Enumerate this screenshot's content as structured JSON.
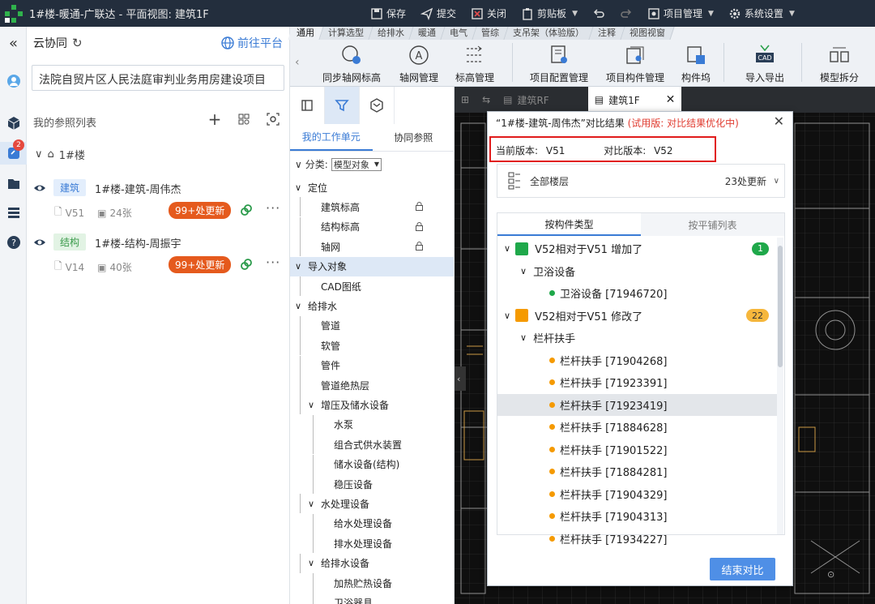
{
  "titlebar": {
    "title": "1#楼-暖通-广联达 - 平面视图: 建筑1F",
    "save": "保存",
    "submit": "提交",
    "close": "关闭",
    "clipboard": "剪贴板",
    "project_mgmt": "项目管理",
    "system_settings": "系统设置"
  },
  "collab": {
    "title": "云协同",
    "goto_platform": "前往平台",
    "project_name": "法院自贸片区人民法庭审判业务用房建设项目",
    "ref_list_title": "我的参照列表",
    "root_node": "1#楼",
    "refs": [
      {
        "tag": "建筑",
        "name": "1#楼-建筑-周伟杰",
        "version": "V51",
        "sheets": "24张",
        "updates": "99+处更新",
        "tag_bg": "#e3eefc",
        "tag_color": "#3a7bd5"
      },
      {
        "tag": "结构",
        "name": "1#楼-结构-周振宇",
        "version": "V14",
        "sheets": "40张",
        "updates": "99+处更新",
        "tag_bg": "#e2f3e4",
        "tag_color": "#3a9a4a"
      }
    ],
    "rail_badge": "2"
  },
  "ribbon": {
    "tabs": [
      "通用",
      "计算选型",
      "给排水",
      "暖通",
      "电气",
      "管综",
      "支吊架（体验版）",
      "注释",
      "视图视窗"
    ],
    "buttons": [
      "同步轴网标高",
      "轴网管理",
      "标高管理",
      "项目配置管理",
      "项目构件管理",
      "构件坞",
      "导入导出",
      "模型拆分"
    ]
  },
  "workunit": {
    "tabs": [
      "我的工作单元",
      "协同参照"
    ],
    "filter_label": "分类:",
    "filter_value": "模型对象",
    "tree": [
      {
        "text": "定位",
        "level": 0,
        "exp": "∨"
      },
      {
        "text": "建筑标高",
        "level": 1,
        "lock": true
      },
      {
        "text": "结构标高",
        "level": 1,
        "lock": true
      },
      {
        "text": "轴网",
        "level": 1,
        "lock": true
      },
      {
        "text": "导入对象",
        "level": 0,
        "exp": "∨",
        "selected": true
      },
      {
        "text": "CAD图纸",
        "level": 1
      },
      {
        "text": "给排水",
        "level": 0,
        "exp": "∨"
      },
      {
        "text": "管道",
        "level": 1
      },
      {
        "text": "软管",
        "level": 1
      },
      {
        "text": "管件",
        "level": 1
      },
      {
        "text": "管道绝热层",
        "level": 1
      },
      {
        "text": "增压及储水设备",
        "level": 1,
        "exp": "∨"
      },
      {
        "text": "水泵",
        "level": 2
      },
      {
        "text": "组合式供水装置",
        "level": 2
      },
      {
        "text": "储水设备(结构)",
        "level": 2
      },
      {
        "text": "稳压设备",
        "level": 2
      },
      {
        "text": "水处理设备",
        "level": 1,
        "exp": "∨"
      },
      {
        "text": "给水处理设备",
        "level": 2
      },
      {
        "text": "排水处理设备",
        "level": 2
      },
      {
        "text": "给排水设备",
        "level": 1,
        "exp": "∨"
      },
      {
        "text": "加热贮热设备",
        "level": 2
      },
      {
        "text": "卫浴器具",
        "level": 2
      }
    ]
  },
  "views": {
    "tab1": "建筑RF",
    "tab2": "建筑1F"
  },
  "dialog": {
    "title": "“1#楼-建筑-周伟杰”对比结果",
    "trial_note": "(试用版: 对比结果优化中)",
    "current_label": "当前版本:",
    "current_value": "V51",
    "compare_label": "对比版本:",
    "compare_value": "V52",
    "floors_label": "全部楼层",
    "floors_count": "23处更新",
    "tabs": [
      "按构件类型",
      "按平铺列表"
    ],
    "rows": [
      {
        "kind": "group",
        "text": "V52相对于V51 增加了",
        "color": "#1fa84a",
        "badge": "1",
        "badge_bg": "#1fa84a",
        "badge_fg": "#fff"
      },
      {
        "kind": "cat",
        "text": "卫浴设备"
      },
      {
        "kind": "item",
        "text": "卫浴设备 [71946720]",
        "color": "#1fa84a"
      },
      {
        "kind": "group",
        "text": "V52相对于V51 修改了",
        "color": "#f59a00",
        "badge": "22",
        "badge_bg": "#f6b73c",
        "badge_fg": "#333"
      },
      {
        "kind": "cat",
        "text": "栏杆扶手"
      },
      {
        "kind": "item",
        "text": "栏杆扶手 [71904268]",
        "color": "#f59a00"
      },
      {
        "kind": "item",
        "text": "栏杆扶手 [71923391]",
        "color": "#f59a00"
      },
      {
        "kind": "item",
        "text": "栏杆扶手 [71923419]",
        "color": "#f59a00",
        "selected": true
      },
      {
        "kind": "item",
        "text": "栏杆扶手 [71884628]",
        "color": "#f59a00"
      },
      {
        "kind": "item",
        "text": "栏杆扶手 [71901522]",
        "color": "#f59a00"
      },
      {
        "kind": "item",
        "text": "栏杆扶手 [71884281]",
        "color": "#f59a00"
      },
      {
        "kind": "item",
        "text": "栏杆扶手 [71904329]",
        "color": "#f59a00"
      },
      {
        "kind": "item",
        "text": "栏杆扶手 [71904313]",
        "color": "#f59a00"
      },
      {
        "kind": "item",
        "text": "栏杆扶手 [71934227]",
        "color": "#f59a00"
      }
    ],
    "end_button": "结束对比"
  }
}
